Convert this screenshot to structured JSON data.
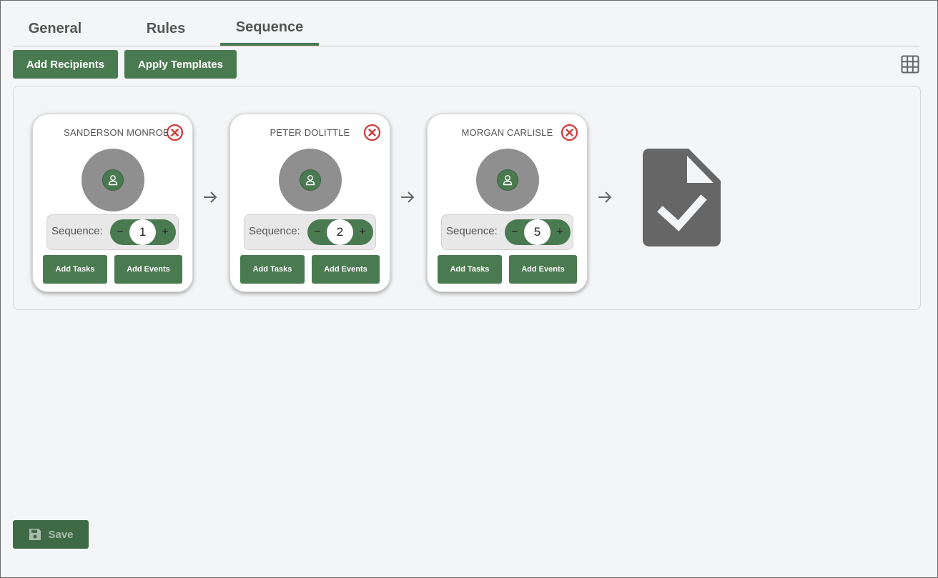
{
  "tabs": [
    {
      "label": "General"
    },
    {
      "label": "Rules"
    },
    {
      "label": "Sequence"
    }
  ],
  "toolbar": {
    "add_recipients": "Add Recipients",
    "apply_templates": "Apply Templates"
  },
  "recipients": [
    {
      "name": "SANDERSON MONROE, III",
      "sequence_label": "Sequence:",
      "sequence": "1",
      "add_tasks": "Add Tasks",
      "add_events": "Add Events"
    },
    {
      "name": "PETER DOLITTLE",
      "sequence_label": "Sequence:",
      "sequence": "2",
      "add_tasks": "Add Tasks",
      "add_events": "Add Events"
    },
    {
      "name": "MORGAN CARLISLE",
      "sequence_label": "Sequence:",
      "sequence": "5",
      "add_tasks": "Add Tasks",
      "add_events": "Add Events"
    }
  ],
  "stepper": {
    "minus": "−",
    "plus": "+"
  },
  "footer": {
    "save_label": "Save"
  },
  "icons": {
    "grid": "grid-icon",
    "remove": "close-circle-icon",
    "avatar": "user-icon",
    "arrow": "arrow-right-icon",
    "document": "document-check-icon",
    "save": "floppy-disk-icon"
  },
  "colors": {
    "accent": "#4a7a50",
    "remove": "#d0393b",
    "avatar_bg": "#8f8f8f",
    "doc": "#666666"
  }
}
